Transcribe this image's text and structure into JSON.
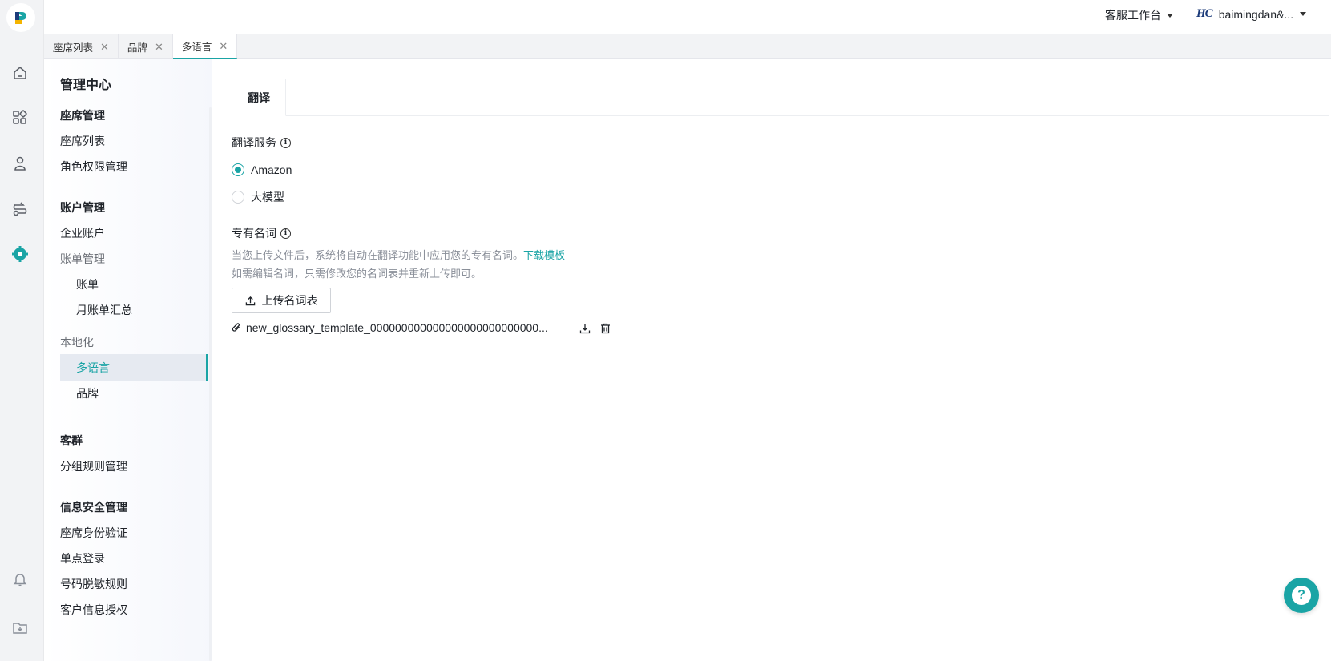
{
  "header": {
    "workspace_label": "客服工作台",
    "user_logo_text": "HC",
    "user_name": "baimingdan&..."
  },
  "tabs": [
    {
      "label": "座席列表"
    },
    {
      "label": "品牌"
    },
    {
      "label": "多语言"
    }
  ],
  "sidemenu": {
    "title": "管理中心",
    "seat_group": "座席管理",
    "seat_list": "座席列表",
    "role_perm": "角色权限管理",
    "account_group": "账户管理",
    "enterprise_account": "企业账户",
    "billing_mgmt": "账单管理",
    "bill": "账单",
    "monthly_bill": "月账单汇总",
    "localization": "本地化",
    "multilingual": "多语言",
    "brand": "品牌",
    "customer_group": "客群",
    "group_rules": "分组规则管理",
    "infosec_group": "信息安全管理",
    "seat_auth": "座席身份验证",
    "sso": "单点登录",
    "number_mask": "号码脱敏规则",
    "customer_auth": "客户信息授权"
  },
  "content": {
    "tab_label": "翻译",
    "translate_service_label": "翻译服务",
    "radio_options": [
      {
        "label": "Amazon",
        "selected": true
      },
      {
        "label": "大模型",
        "selected": false
      }
    ],
    "glossary_label": "专有名词",
    "desc_line1": "当您上传文件后，系统将自动在翻译功能中应用您的专有名词。",
    "download_template": "下载模板",
    "desc_line2": "如需编辑名词，只需修改您的名词表并重新上传即可。",
    "upload_button": "上传名词表",
    "file_name": "new_glossary_template_000000000000000000000000000..."
  },
  "colors": {
    "accent": "#1aa4a5",
    "rail_bg": "#f2f3f5"
  },
  "icons": {
    "rail": [
      "home-icon",
      "apps-icon",
      "contacts-icon",
      "workflow-icon",
      "settings-icon",
      "bell-icon",
      "download-box-icon"
    ],
    "fab": "help-icon"
  }
}
